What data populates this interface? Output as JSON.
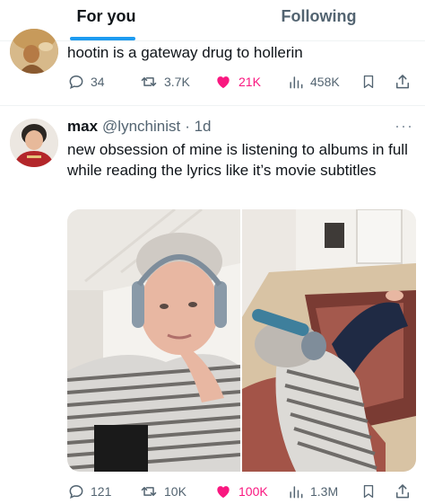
{
  "tabs": [
    {
      "label": "For you",
      "active": true
    },
    {
      "label": "Following",
      "active": false
    }
  ],
  "tweets": [
    {
      "text": "hootin is a gateway drug to hollerin",
      "replies": "34",
      "retweets": "3.7K",
      "likes": "21K",
      "views": "458K"
    },
    {
      "display_name": "max",
      "handle": "@lynchinist",
      "time": "· 1d",
      "more": "···",
      "text": "new obsession of mine is listening to albums in full while reading the lyrics like it’s movie subtitles",
      "replies": "121",
      "retweets": "10K",
      "likes": "100K",
      "views": "1.3M"
    }
  ],
  "colors": {
    "accent": "#1d9bf0",
    "like": "#f91880",
    "muted": "#536471",
    "divider": "#eff3f4"
  },
  "icons": [
    "reply-icon",
    "retweet-icon",
    "heart-filled-icon",
    "views-icon",
    "bookmark-icon",
    "share-icon"
  ]
}
